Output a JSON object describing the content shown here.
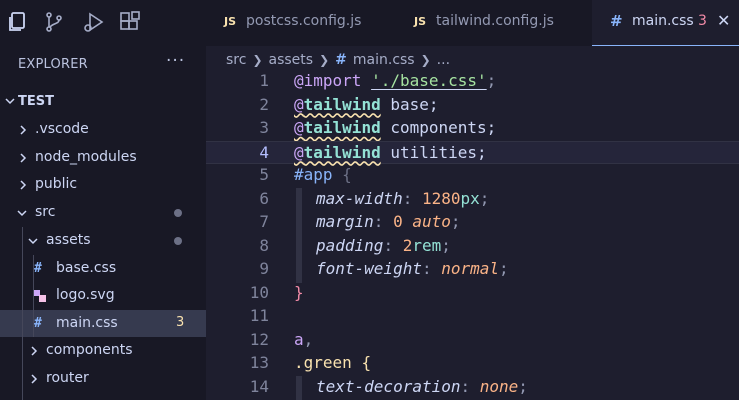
{
  "activity_bar": {
    "icons": [
      "files-icon",
      "source-control-icon",
      "run-debug-icon",
      "extensions-icon"
    ]
  },
  "sidebar": {
    "title": "EXPLORER",
    "more": "···",
    "project": "TEST",
    "items": [
      {
        "label": ".vscode",
        "type": "folder",
        "level": 1
      },
      {
        "label": "node_modules",
        "type": "folder",
        "level": 1
      },
      {
        "label": "public",
        "type": "folder",
        "level": 1
      },
      {
        "label": "src",
        "type": "folder-open",
        "level": 1
      },
      {
        "label": "assets",
        "type": "folder-open",
        "level": 2
      },
      {
        "label": "base.css",
        "type": "css",
        "level": 3
      },
      {
        "label": "logo.svg",
        "type": "svg",
        "level": 3
      },
      {
        "label": "main.css",
        "type": "css",
        "level": 3,
        "count": "3"
      },
      {
        "label": "components",
        "type": "folder",
        "level": 2
      },
      {
        "label": "router",
        "type": "folder",
        "level": 2
      }
    ]
  },
  "tabs": [
    {
      "label": "postcss.config.js",
      "type": "js",
      "badge": "JS"
    },
    {
      "label": "tailwind.config.js",
      "type": "js",
      "badge": "JS"
    },
    {
      "label": "main.css",
      "type": "css",
      "badge": "#",
      "problems": "3",
      "active": true
    }
  ],
  "breadcrumb": {
    "parts": [
      "src",
      "assets",
      "main.css",
      "..."
    ],
    "hash": "#"
  },
  "editor": {
    "current_line": 4,
    "line_numbers": [
      "1",
      "2",
      "3",
      "4",
      "5",
      "6",
      "7",
      "8",
      "9",
      "10",
      "11",
      "12",
      "13",
      "14"
    ],
    "tokens": {
      "l1_at": "@import",
      "l1_str": "'./base.css'",
      "l1_semi": ";",
      "l2_at": "@",
      "l2_kw": "tailwind",
      "l2_val": " base;",
      "l3_at": "@",
      "l3_kw": "tailwind",
      "l3_val": " components;",
      "l4_at": "@",
      "l4_kw": "tailwind",
      "l4_val": " utilities;",
      "l5_hash": "#",
      "l5_id": "app",
      "l5_brace": " {",
      "l6_prop": "max-width",
      "l6_colon": ": ",
      "l6_num": "1280",
      "l6_unit": "px",
      "l6_semi": ";",
      "l7_prop": "margin",
      "l7_colon": ": ",
      "l7_num": "0",
      "l7_val": " auto",
      "l7_semi": ";",
      "l8_prop": "padding",
      "l8_colon": ": ",
      "l8_num": "2",
      "l8_unit": "rem",
      "l8_semi": ";",
      "l9_prop": "font-weight",
      "l9_colon": ": ",
      "l9_val": "normal",
      "l9_semi": ";",
      "l10_brace": "}",
      "l12_tag": "a",
      "l12_comma": ",",
      "l13_dot": ".",
      "l13_cls": "green",
      "l13_brace": " {",
      "l14_prop": "text-decoration",
      "l14_colon": ": ",
      "l14_val": "none",
      "l14_semi": ";"
    }
  },
  "colors": {
    "background": "#1e1e2e",
    "sidebar": "#181825",
    "accent": "#89b4fa",
    "warning": "#f9e2af",
    "error": "#f38ba8"
  }
}
